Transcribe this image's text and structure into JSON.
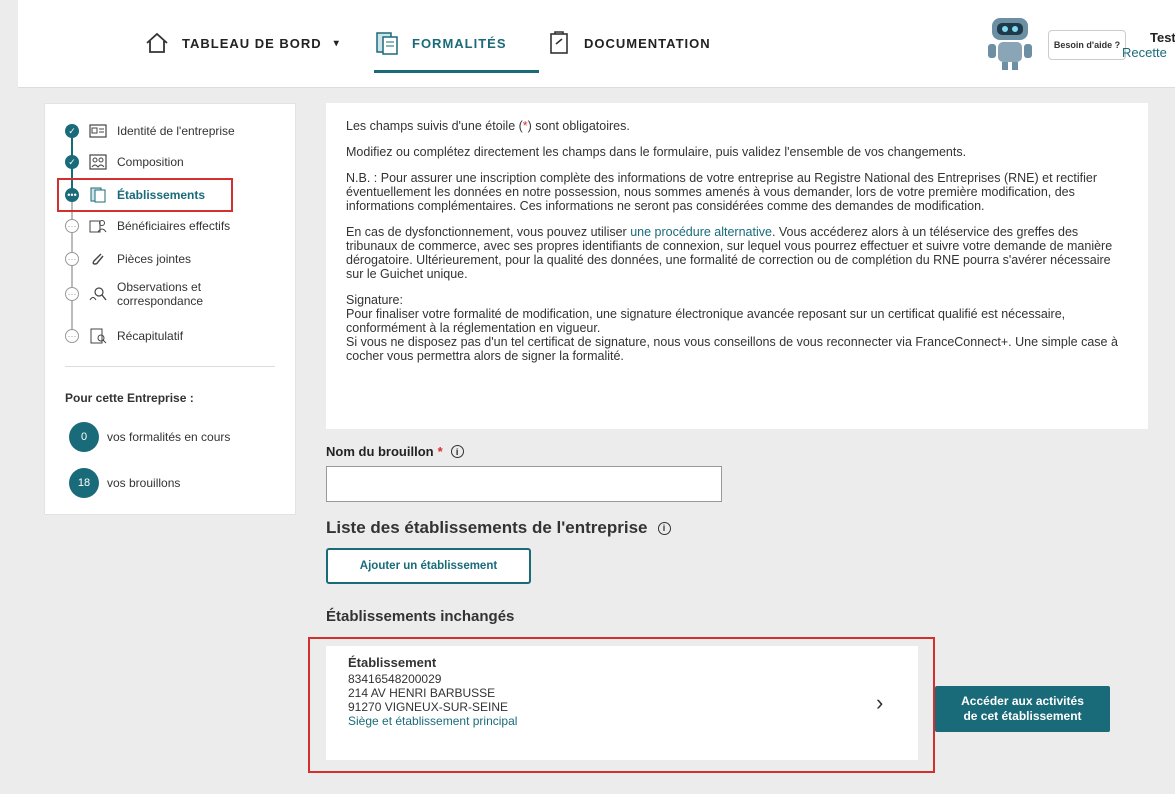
{
  "nav": {
    "dashboard": "TABLEAU DE BORD",
    "formalities": "FORMALITÉS",
    "documentation": "DOCUMENTATION",
    "help": "Besoin d'aide ?",
    "user_name": "Test",
    "user_role": "Recette"
  },
  "sidebar": {
    "steps": [
      {
        "label": "Identité de l'entreprise",
        "status": "done"
      },
      {
        "label": "Composition",
        "status": "done"
      },
      {
        "label": "Établissements",
        "status": "current"
      },
      {
        "label": "Bénéficiaires effectifs",
        "status": "todo"
      },
      {
        "label": "Pièces jointes",
        "status": "todo"
      },
      {
        "label": "Observations et",
        "label2": "correspondance",
        "status": "todo"
      },
      {
        "label": "Récapitulatif",
        "status": "todo"
      }
    ],
    "for_company_title": "Pour cette Entreprise :",
    "counters": [
      {
        "value": "0",
        "label": "vos formalités en cours"
      },
      {
        "value": "18",
        "label": "vos brouillons"
      }
    ]
  },
  "info": {
    "required_pre": "Les champs suivis d'une étoile (",
    "required_star": "*",
    "required_post": ") sont obligatoires.",
    "modify": "Modifiez ou complétez directement les champs dans le formulaire, puis validez l'ensemble de vos changements.",
    "nb": "N.B. : Pour assurer une inscription complète des informations de votre entreprise au Registre National des Entreprises (RNE) et rectifier éventuellement les données en notre possession, nous sommes amenés à vous demander, lors de votre première modification, des informations complémentaires. Ces informations ne seront pas considérées comme des demandes de modification.",
    "dys_pre": "En cas de dysfonctionnement, vous pouvez utiliser ",
    "dys_link": "une procédure alternative",
    "dys_post": ". Vous accéderez alors à un téléservice des greffes des tribunaux de commerce, avec ses propres identifiants de connexion, sur lequel vous pourrez effectuer et suivre votre demande de manière dérogatoire. Ultérieurement, pour la qualité des données, une formalité de correction ou de complétion du RNE pourra s'avérer nécessaire sur le Guichet unique.",
    "sig_title": "Signature:",
    "sig_1": "Pour finaliser votre formalité de modification, une signature électronique avancée reposant sur un certificat qualifié est nécessaire, conformément à la réglementation en vigueur.",
    "sig_2": "Si vous ne disposez pas d'un tel certificat de signature, nous vous conseillons de vous reconnecter via FranceConnect+. Une simple case à cocher vous permettra alors de signer la formalité."
  },
  "draft": {
    "label": "Nom du brouillon",
    "star": "*",
    "value": ""
  },
  "establishments": {
    "title": "Liste des établissements de l'entreprise",
    "add_button": "Ajouter un établissement",
    "unchanged_title": "Établissements inchangés",
    "card": {
      "title": "Établissement",
      "siret": "83416548200029",
      "address1": "214 AV HENRI BARBUSSE",
      "address2": "91270 VIGNEUX-SUR-SEINE",
      "type": "Siège et établissement principal"
    },
    "activities_button_1": "Accéder aux activités",
    "activities_button_2": "de cet établissement"
  },
  "colors": {
    "accent": "#1a6b7a",
    "highlight": "#d32f2f"
  }
}
